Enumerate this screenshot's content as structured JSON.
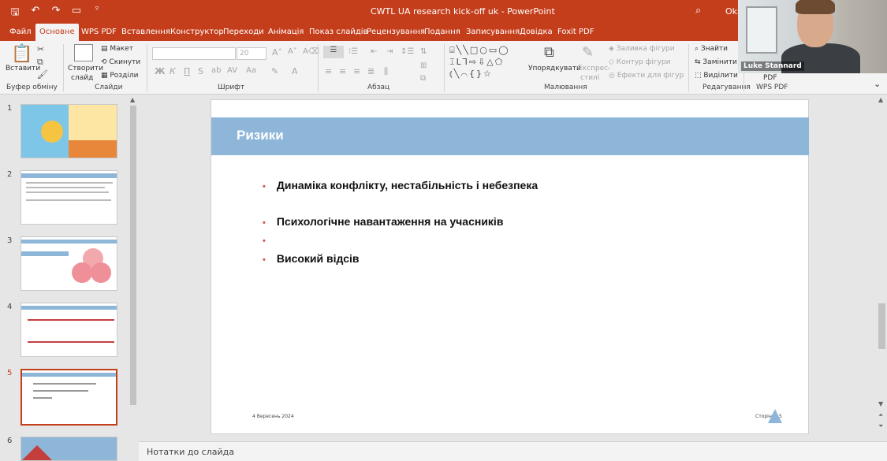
{
  "window": {
    "title": "CWTL UA research kick-off uk  -  PowerPoint",
    "user": "Oksa",
    "quick_access": [
      "save-icon",
      "undo-icon",
      "redo-icon",
      "present-icon",
      "more-icon"
    ]
  },
  "tabs": [
    {
      "label": "Файл"
    },
    {
      "label": "Основне"
    },
    {
      "label": "WPS PDF"
    },
    {
      "label": "Вставлення"
    },
    {
      "label": "Конструктор"
    },
    {
      "label": "Переходи"
    },
    {
      "label": "Анімація"
    },
    {
      "label": "Показ слайдів"
    },
    {
      "label": "Рецензування"
    },
    {
      "label": "Подання"
    },
    {
      "label": "Записування"
    },
    {
      "label": "Довідка"
    },
    {
      "label": "Foxit PDF"
    }
  ],
  "ribbon": {
    "clipboard": {
      "paste": "Вставити",
      "label": "Буфер обміну"
    },
    "slides": {
      "new_slide_1": "Створити",
      "new_slide_2": "слайд",
      "layout": "Макет",
      "reset": "Скинути",
      "sections": "Розділи",
      "label": "Слайди"
    },
    "font": {
      "size": "20",
      "label": "Шрифт",
      "bold": "Ж",
      "italic": "К",
      "underline": "П",
      "strike": "S",
      "shadow": "ab",
      "case": "Aa"
    },
    "paragraph": {
      "label": "Абзац"
    },
    "drawing": {
      "arrange": "Упорядкувати",
      "express_1": "Експрес-",
      "express_2": "стилі",
      "fill": "Заливка фігури",
      "outline": "Контур фігури",
      "effects": "Ефекти для фігур",
      "label": "Малювання"
    },
    "editing": {
      "find": "Знайти",
      "replace": "Замінити",
      "select": "Виділити",
      "label": "Редагування"
    },
    "wps": {
      "pdf": "PDF",
      "label": "WPS PDF"
    }
  },
  "video": {
    "name": "Luke Stannard"
  },
  "thumbnails": [
    {
      "num": "1",
      "selected": false
    },
    {
      "num": "2",
      "selected": false
    },
    {
      "num": "3",
      "selected": false
    },
    {
      "num": "4",
      "selected": false
    },
    {
      "num": "5",
      "selected": true
    },
    {
      "num": "6",
      "selected": false
    }
  ],
  "slide": {
    "title": "Ризики",
    "bullets": [
      "Динаміка конфлікту, нестабільність і небезпека",
      "Психологічне навантаження на учасників",
      "",
      "Високий відсів"
    ],
    "footer_date": "4 Вересень 2024",
    "footer_page": "Сторінка 5"
  },
  "notes": {
    "placeholder": "Нотатки до слайда"
  },
  "colors": {
    "accent": "#c43e1c",
    "banner": "#8db6d9",
    "bullet": "#d9535f"
  }
}
